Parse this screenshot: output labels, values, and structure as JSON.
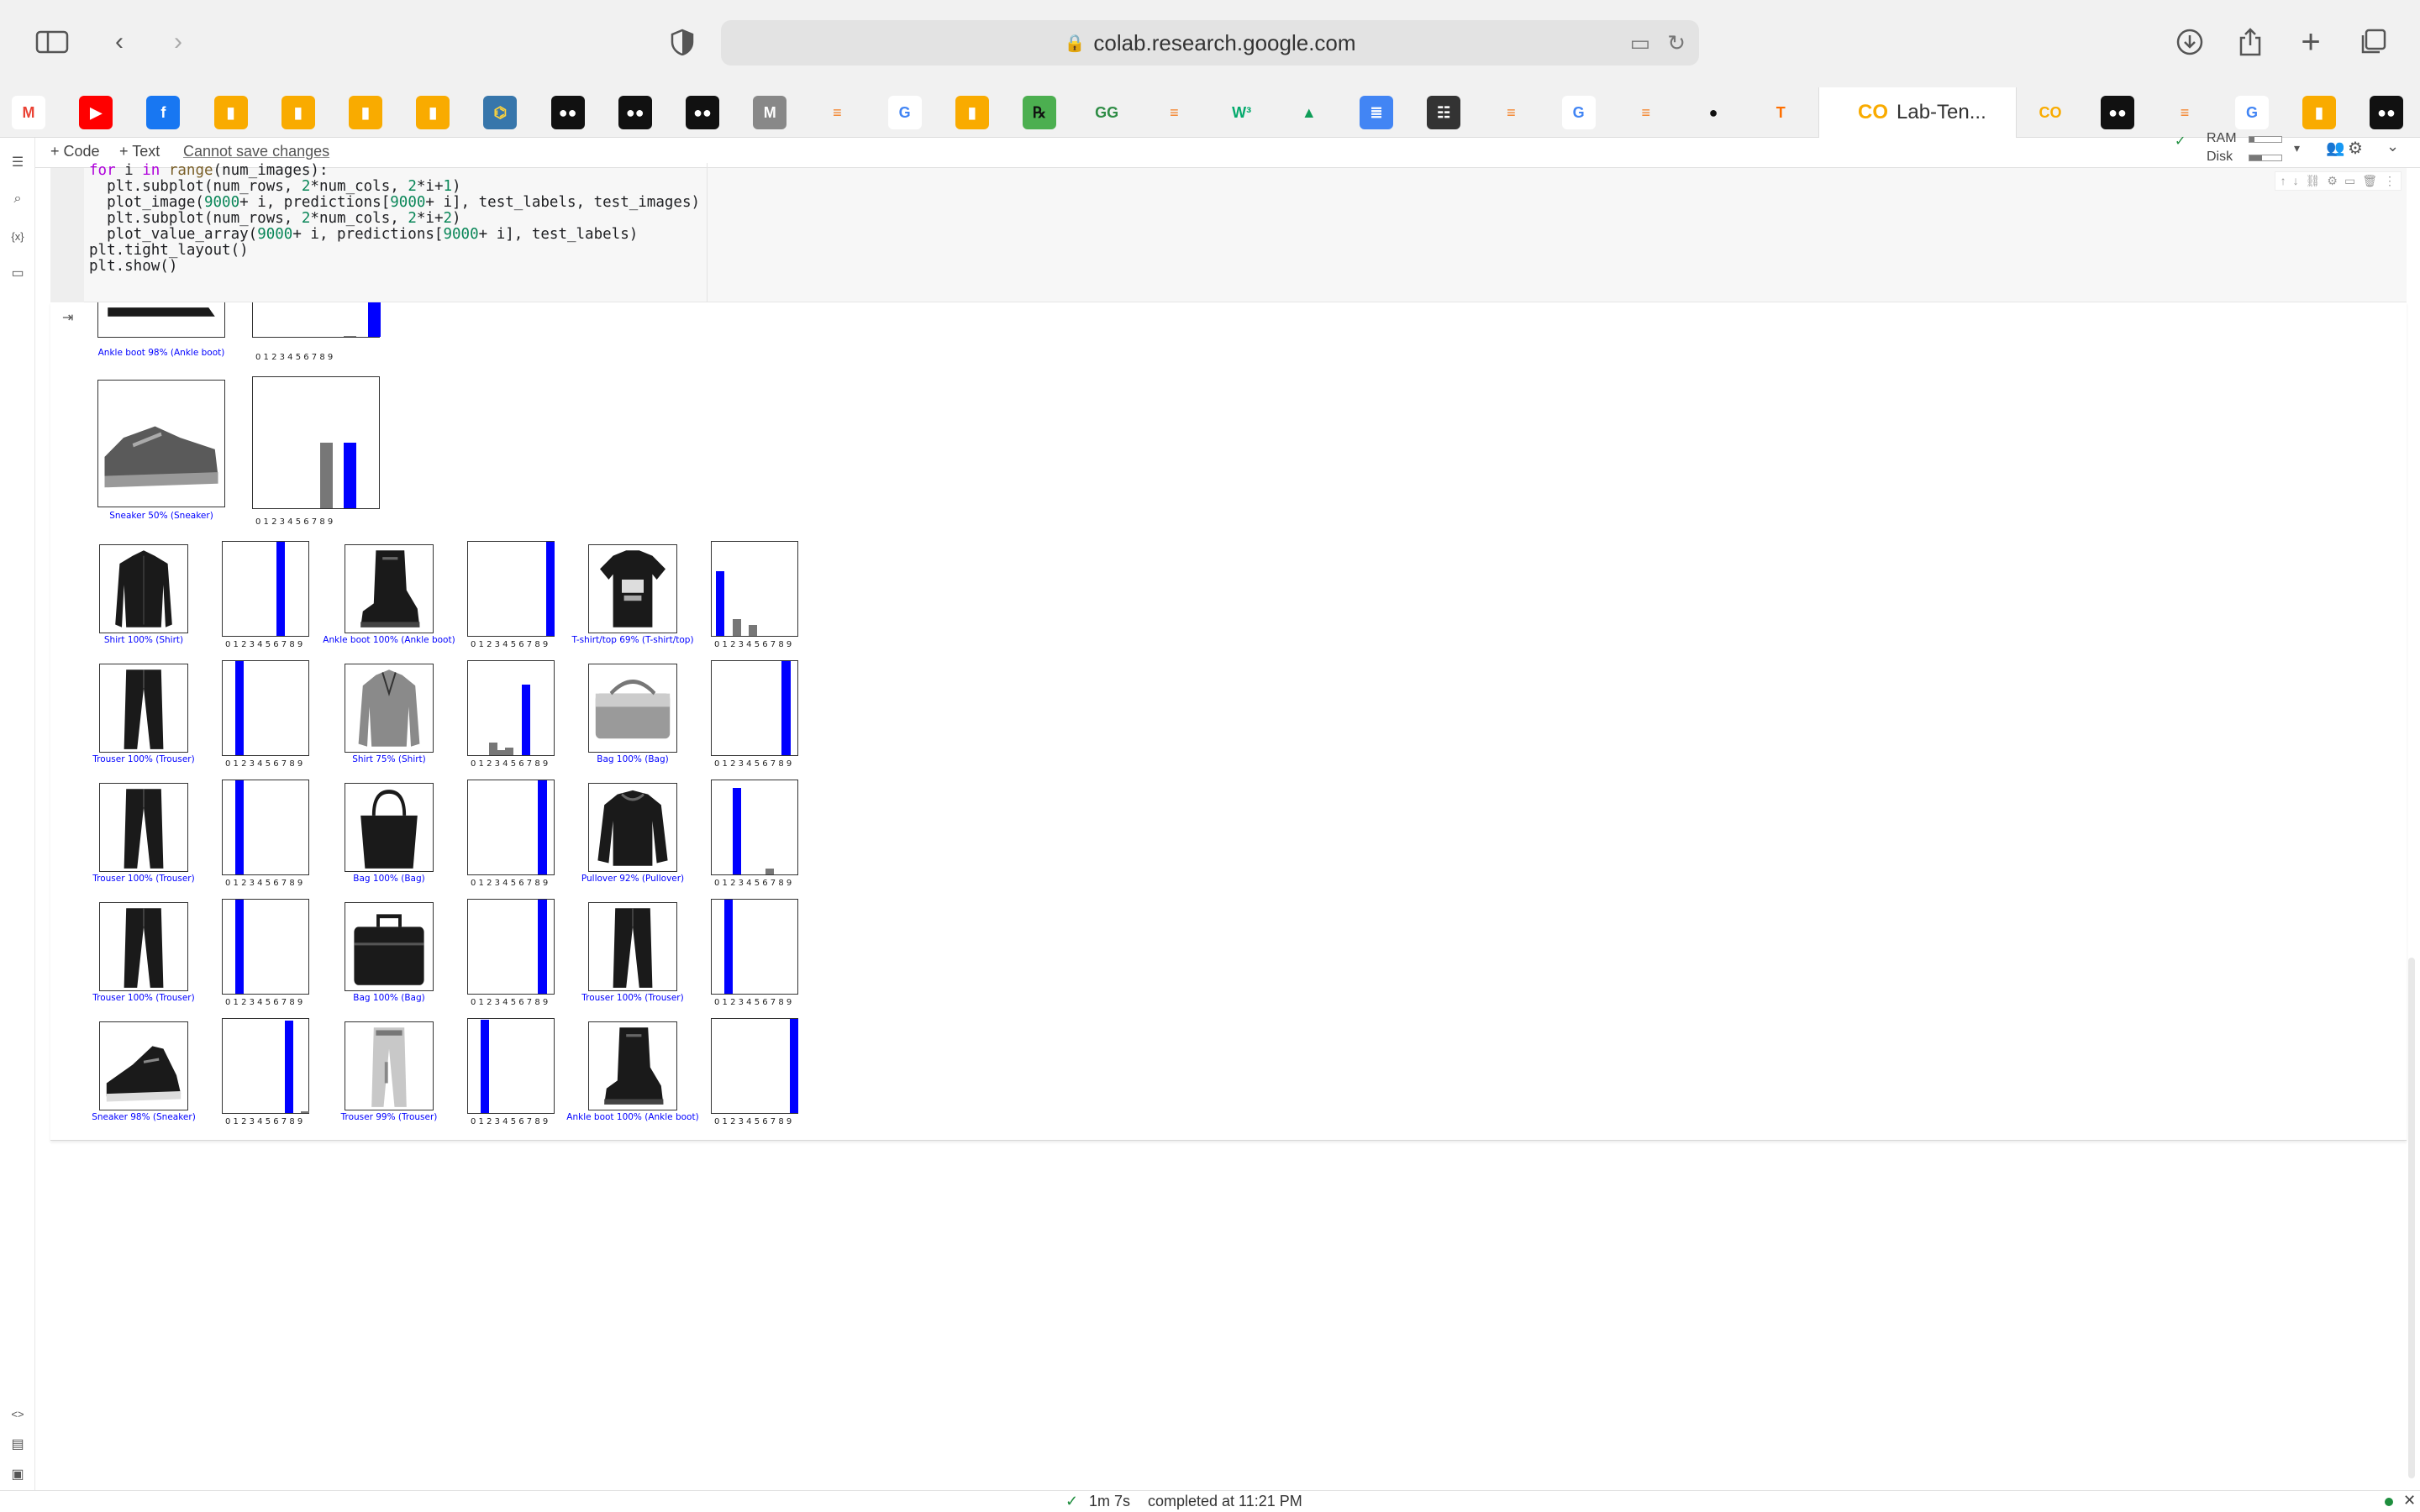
{
  "browser": {
    "url": "colab.research.google.com",
    "active_tab_title": "Lab-Ten...",
    "bookmarks": [
      "gmail-icon",
      "youtube-icon",
      "facebook-icon",
      "analytics-icon",
      "analytics-icon",
      "analytics-icon",
      "analytics-icon",
      "python-icon",
      "medium-icon",
      "medium-icon",
      "medium-icon",
      "m-icon",
      "stackoverflow-icon",
      "google-icon",
      "analytics-icon",
      "rx-icon",
      "geeksforgeeks-icon",
      "stackoverflow-icon",
      "w3schools-icon",
      "drive-icon",
      "docs-icon",
      "forms-icon",
      "stackoverflow-icon",
      "google-icon",
      "stackoverflow-icon",
      "github-icon",
      "tensorflow-icon"
    ],
    "after_tab_icons": [
      "colab-icon",
      "medium-icon",
      "stackoverflow-icon",
      "google-icon",
      "analytics-icon",
      "medium-icon"
    ]
  },
  "colab": {
    "add_code": "+ Code",
    "add_text": "+ Text",
    "cannot_save": "Cannot save changes",
    "ram_label": "RAM",
    "disk_label": "Disk"
  },
  "code_lines": [
    "for i in range(num_images):",
    "  plt.subplot(num_rows, 2*num_cols, 2*i+1)",
    "  plot_image(9000+ i, predictions[9000+ i], test_labels, test_images)",
    "  plt.subplot(num_rows, 2*num_cols, 2*i+2)",
    "  plot_value_array(9000+ i, predictions[9000+ i], test_labels)",
    "plt.tight_layout()",
    "plt.show()"
  ],
  "ticks": "0 1 2 3 4 5 6 7 8 9",
  "output_top": [
    {
      "caption": "Ankle boot 98% (Ankle boot)",
      "garment": "boot-low",
      "bars": [
        0,
        0,
        0,
        0,
        0,
        0,
        0,
        0.02,
        0,
        0.98
      ],
      "pred": 9
    },
    {
      "caption": "Sneaker 50% (Sneaker)",
      "garment": "sneaker",
      "bars": [
        0,
        0,
        0,
        0,
        0,
        0.5,
        0,
        0.5,
        0,
        0
      ],
      "pred": 7
    }
  ],
  "grid_rows": [
    [
      {
        "caption": "Shirt 100% (Shirt)",
        "garment": "shirt",
        "bars": [
          0,
          0,
          0,
          0,
          0,
          0,
          1,
          0,
          0,
          0
        ],
        "pred": 6
      },
      {
        "caption": "Ankle boot 100% (Ankle boot)",
        "garment": "boot",
        "bars": [
          0,
          0,
          0,
          0,
          0,
          0,
          0,
          0,
          0,
          1
        ],
        "pred": 9
      },
      {
        "caption": "T-shirt/top 69% (T-shirt/top)",
        "garment": "tshirt",
        "bars": [
          0.69,
          0,
          0.18,
          0,
          0.12,
          0,
          0,
          0,
          0,
          0
        ],
        "pred": 0
      }
    ],
    [
      {
        "caption": "Trouser 100% (Trouser)",
        "garment": "trouser",
        "bars": [
          0,
          1,
          0,
          0,
          0,
          0,
          0,
          0,
          0,
          0
        ],
        "pred": 1
      },
      {
        "caption": "Shirt 75% (Shirt)",
        "garment": "shirt-gray",
        "bars": [
          0,
          0,
          0.13,
          0.05,
          0.08,
          0,
          0.75,
          0,
          0,
          0
        ],
        "pred": 6
      },
      {
        "caption": "Bag 100% (Bag)",
        "garment": "bag-flat",
        "bars": [
          0,
          0,
          0,
          0,
          0,
          0,
          0,
          0,
          1,
          0
        ],
        "pred": 8
      }
    ],
    [
      {
        "caption": "Trouser 100% (Trouser)",
        "garment": "trouser",
        "bars": [
          0,
          1,
          0,
          0,
          0,
          0,
          0,
          0,
          0,
          0
        ],
        "pred": 1
      },
      {
        "caption": "Bag 100% (Bag)",
        "garment": "tote",
        "bars": [
          0,
          0,
          0,
          0,
          0,
          0,
          0,
          0,
          1,
          0
        ],
        "pred": 8
      },
      {
        "caption": "Pullover 92% (Pullover)",
        "garment": "pullover",
        "bars": [
          0,
          0,
          0.92,
          0,
          0,
          0,
          0.06,
          0,
          0,
          0
        ],
        "pred": 2
      }
    ],
    [
      {
        "caption": "Trouser 100% (Trouser)",
        "garment": "trouser",
        "bars": [
          0,
          1,
          0,
          0,
          0,
          0,
          0,
          0,
          0,
          0
        ],
        "pred": 1
      },
      {
        "caption": "Bag 100% (Bag)",
        "garment": "briefcase",
        "bars": [
          0,
          0,
          0,
          0,
          0,
          0,
          0,
          0,
          1,
          0
        ],
        "pred": 8
      },
      {
        "caption": "Trouser 100% (Trouser)",
        "garment": "trouser",
        "bars": [
          0,
          1,
          0,
          0,
          0,
          0,
          0,
          0,
          0,
          0
        ],
        "pred": 1
      }
    ],
    [
      {
        "caption": "Sneaker 98% (Sneaker)",
        "garment": "sneaker-hi",
        "bars": [
          0,
          0,
          0,
          0,
          0,
          0,
          0,
          0.98,
          0,
          0.02
        ],
        "pred": 7
      },
      {
        "caption": "Trouser 99% (Trouser)",
        "garment": "trouser-light",
        "bars": [
          0,
          0.99,
          0,
          0,
          0,
          0,
          0,
          0,
          0,
          0
        ],
        "pred": 1
      },
      {
        "caption": "Ankle boot 100% (Ankle boot)",
        "garment": "boot",
        "bars": [
          0,
          0,
          0,
          0,
          0,
          0,
          0,
          0,
          0,
          1
        ],
        "pred": 9
      }
    ]
  ],
  "status": {
    "check": "✓",
    "duration": "1m 7s",
    "completed": "completed at 11:21 PM"
  }
}
